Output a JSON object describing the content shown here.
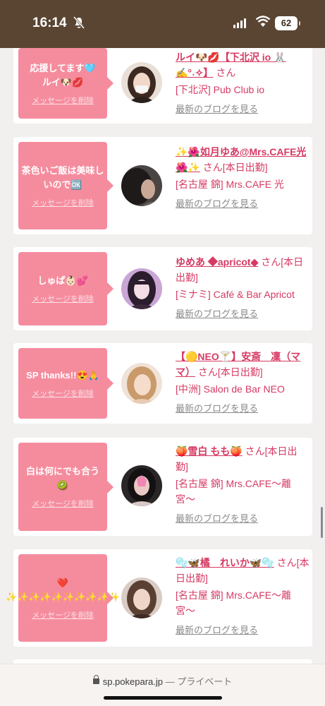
{
  "status": {
    "time": "16:14",
    "battery": "62"
  },
  "browser": {
    "url": "sp.pokepara.jp",
    "separator": "—",
    "mode": "プライベート"
  },
  "colors": {
    "accent": "#d63a63",
    "bubble": "#f58c9e",
    "statusbar": "#5a4533"
  },
  "cards": [
    {
      "message": "応援してます🩵ルイ🐶💋",
      "delete": "メッセージを削除",
      "name": "ルイ🐶💋【下北沢 io 🐰✍️°˖✧】",
      "honorific": "さん",
      "shop": "[下北沢] Pub Club io",
      "blog": "最新のブログを見る"
    },
    {
      "message": "茶色いご飯は美味しいので🆗",
      "delete": "メッセージを削除",
      "name": "✨🌺如月ゆあ@Mrs.CAFE光🌺✨",
      "honorific": "さん[本日出勤]",
      "shop": "[名古屋 錦] Mrs.CAFE 光",
      "blog": "最新のブログを見る"
    },
    {
      "message": "しゅぱ👶🏻💕",
      "delete": "メッセージを削除",
      "name": "ゆめあ ◆apricot◆",
      "honorific": "さん[本日出勤]",
      "shop": "[ミナミ] Café & Bar Apricot",
      "blog": "最新のブログを見る"
    },
    {
      "message": "SP thanks!!😍🙏",
      "delete": "メッセージを削除",
      "name": "【🟡NEO🍸】安斎　凜（ママ）",
      "honorific": "さん[本日出勤]",
      "shop": "[中洲] Salon de Bar NEO",
      "blog": "最新のブログを見る"
    },
    {
      "message": "白は何にでも合う🥝",
      "delete": "メッセージを削除",
      "name": "🍑雪白 もも🍑",
      "honorific": "さん[本日出勤]",
      "shop": "[名古屋 錦] Mrs.CAFE〜離宮〜",
      "blog": "最新のブログを見る"
    },
    {
      "message": "❤️ ✨✨✨✨✨✨✨✨✨✨",
      "delete": "メッセージを削除",
      "name": "🫧🦋橘　れいか🦋🫧",
      "honorific": "さん[本日出勤]",
      "shop": "[名古屋 錦] Mrs.CAFE〜離宮〜",
      "blog": "最新のブログを見る"
    }
  ]
}
